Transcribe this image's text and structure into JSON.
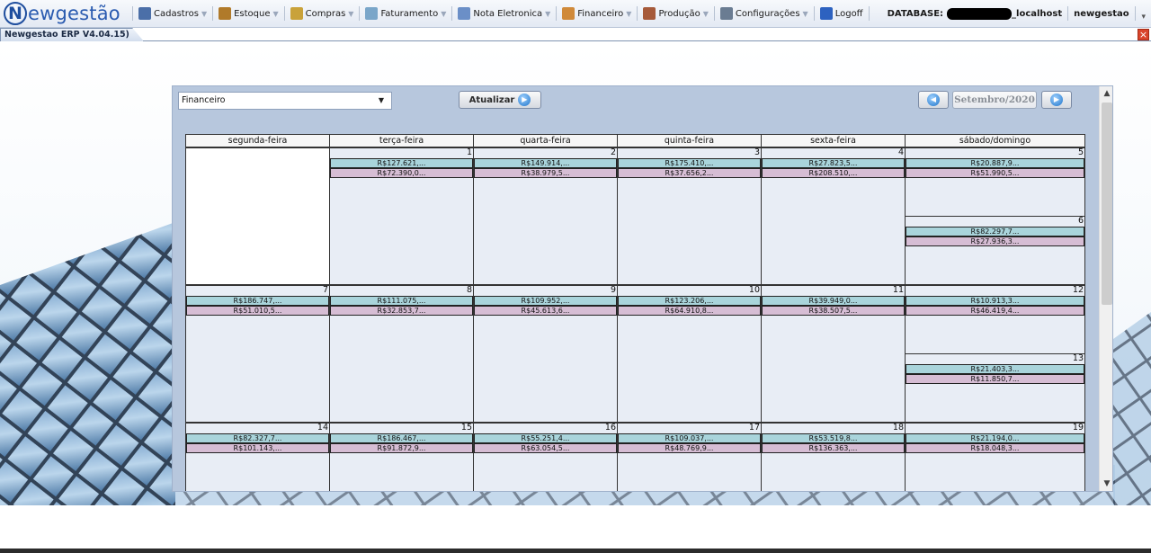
{
  "app": {
    "logo_initial": "N",
    "logo_text": "ewgestão"
  },
  "menu": [
    {
      "label": "Cadastros",
      "icon": "address-book-icon",
      "color": "#4b6fa8"
    },
    {
      "label": "Estoque",
      "icon": "boxes-icon",
      "color": "#b07a2a"
    },
    {
      "label": "Compras",
      "icon": "clipboard-icon",
      "color": "#c9a23a"
    },
    {
      "label": "Faturamento",
      "icon": "document-icon",
      "color": "#7aa6c9"
    },
    {
      "label": "Nota Eletronica",
      "icon": "gear-note-icon",
      "color": "#6b8fc7"
    },
    {
      "label": "Financeiro",
      "icon": "money-icon",
      "color": "#d08a3a"
    },
    {
      "label": "Produção",
      "icon": "production-icon",
      "color": "#a65a3a"
    },
    {
      "label": "Configurações",
      "icon": "settings-icon",
      "color": "#6a7c92"
    }
  ],
  "logoff": {
    "label": "Logoff",
    "icon": "logoff-icon",
    "color": "#2d62c0"
  },
  "database": {
    "label": "DATABASE:",
    "host": "_localhost",
    "name": "newgestao"
  },
  "tab": {
    "title": "Newgestao ERP V4.04.15)",
    "close": "×"
  },
  "toolbar": {
    "combo_value": "Financeiro",
    "refresh_label": "Atualizar",
    "month_label": "Setembro/2020"
  },
  "weekdays": [
    "segunda-feira",
    "terça-feira",
    "quarta-feira",
    "quinta-feira",
    "sexta-feira",
    "sábado/domingo"
  ],
  "weeks": [
    {
      "days": [
        {
          "col": 0,
          "blank": true
        },
        {
          "col": 1,
          "num": "1",
          "rec": "R$127.621,...",
          "pag": "R$72.390,0..."
        },
        {
          "col": 2,
          "num": "2",
          "rec": "R$149.914,...",
          "pag": "R$38.979,5..."
        },
        {
          "col": 3,
          "num": "3",
          "rec": "R$175.410,...",
          "pag": "R$37.656,2..."
        },
        {
          "col": 4,
          "num": "4",
          "rec": "R$27.823,5...",
          "pag": "R$208.510,..."
        },
        {
          "col": 5,
          "num": "5",
          "rec": "R$20.887,9...",
          "pag": "R$51.990,5...",
          "num2": "6",
          "rec2": "R$82.297,7...",
          "pag2": "R$27.936,3..."
        }
      ]
    },
    {
      "days": [
        {
          "col": 0,
          "num": "7",
          "rec": "R$186.747,...",
          "pag": "R$51.010,5..."
        },
        {
          "col": 1,
          "num": "8",
          "rec": "R$111.075,...",
          "pag": "R$32.853,7..."
        },
        {
          "col": 2,
          "num": "9",
          "rec": "R$109.952,...",
          "pag": "R$45.613,6..."
        },
        {
          "col": 3,
          "num": "10",
          "rec": "R$123.206,...",
          "pag": "R$64.910,8..."
        },
        {
          "col": 4,
          "num": "11",
          "rec": "R$39.949,0...",
          "pag": "R$38.507,5..."
        },
        {
          "col": 5,
          "num": "12",
          "rec": "R$10.913,3...",
          "pag": "R$46.419,4...",
          "num2": "13",
          "rec2": "R$21.403,3...",
          "pag2": "R$11.850,7..."
        }
      ]
    },
    {
      "days": [
        {
          "col": 0,
          "num": "14",
          "rec": "R$82.327,7...",
          "pag": "R$101.143,..."
        },
        {
          "col": 1,
          "num": "15",
          "rec": "R$186.467,...",
          "pag": "R$91.872,9..."
        },
        {
          "col": 2,
          "num": "16",
          "rec": "R$55.251,4...",
          "pag": "R$63.054,5..."
        },
        {
          "col": 3,
          "num": "17",
          "rec": "R$109.037,...",
          "pag": "R$48.769,9..."
        },
        {
          "col": 4,
          "num": "18",
          "rec": "R$53.519,8...",
          "pag": "R$136.363,..."
        },
        {
          "col": 5,
          "num": "19",
          "rec": "R$21.194,0...",
          "pag": "R$18.048,3..."
        }
      ]
    }
  ],
  "colors": {
    "receita": "#a9d4db",
    "despesa": "#d6bdd4",
    "panel": "#b7c7dd",
    "cell": "#e8edf5"
  }
}
